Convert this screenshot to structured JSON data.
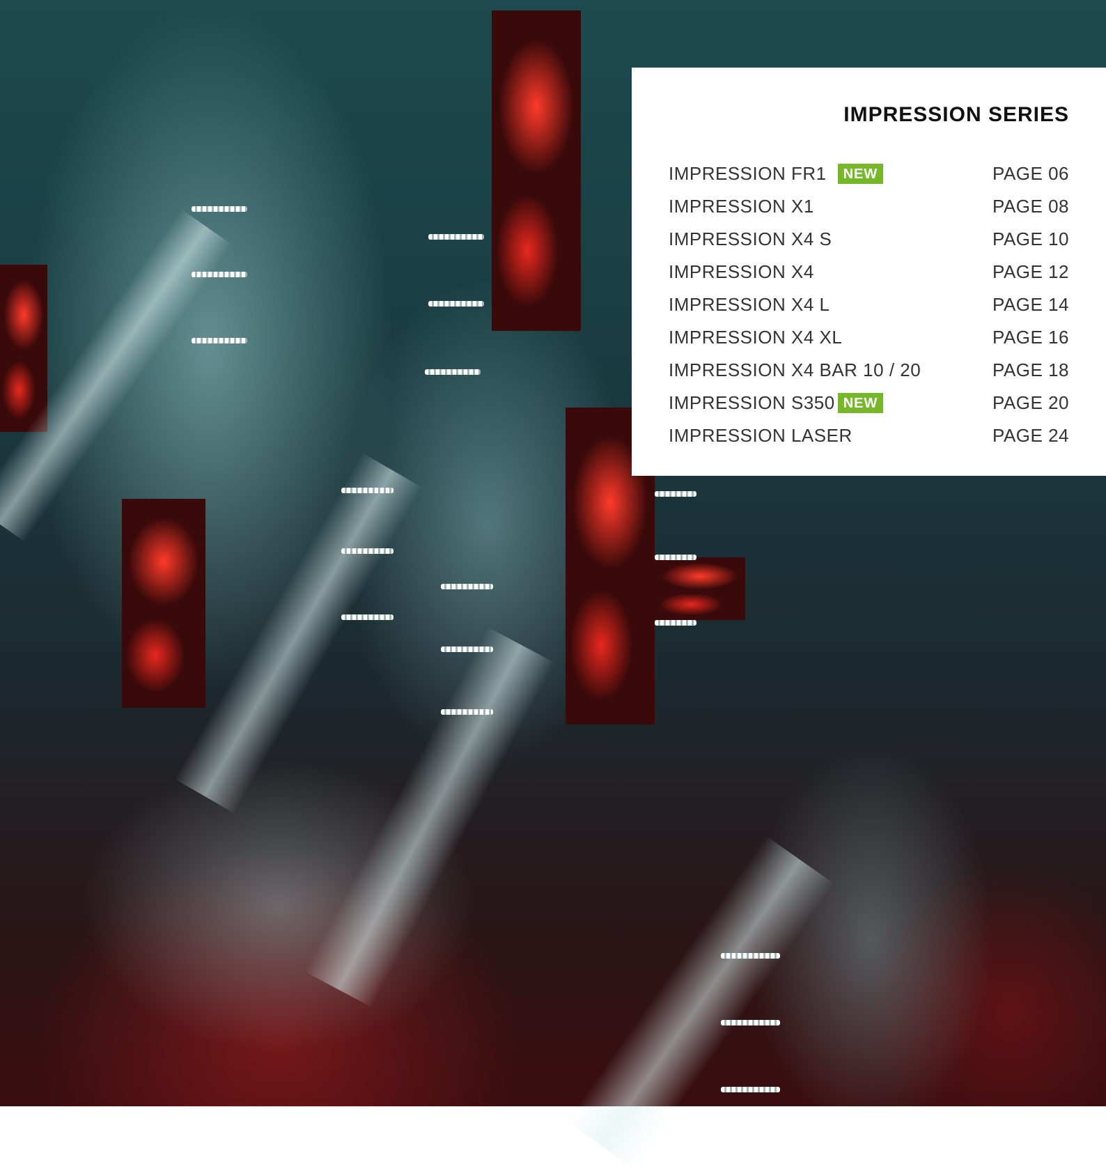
{
  "toc": {
    "title": "IMPRESSION SERIES",
    "items": [
      {
        "name": "IMPRESSION FR1",
        "badge": "NEW",
        "page": "PAGE 06"
      },
      {
        "name": "IMPRESSION X1",
        "badge": "",
        "page": "PAGE 08"
      },
      {
        "name": "IMPRESSION X4 S",
        "badge": "",
        "page": "PAGE 10"
      },
      {
        "name": "IMPRESSION X4",
        "badge": "",
        "page": "PAGE 12"
      },
      {
        "name": "IMPRESSION X4 L",
        "badge": "",
        "page": "PAGE 14"
      },
      {
        "name": "IMPRESSION X4 XL",
        "badge": "",
        "page": "PAGE 16"
      },
      {
        "name": "IMPRESSION X4 BAR 10 / 20",
        "badge": "",
        "page": "PAGE 18"
      },
      {
        "name": "IMPRESSION S350",
        "badge": "NEW",
        "page": "PAGE 20"
      },
      {
        "name": "IMPRESSION LASER",
        "badge": "",
        "page": "PAGE 24"
      }
    ]
  },
  "colors": {
    "badge": "#76b82a",
    "panel": "#ffffff",
    "title_text": "#111111",
    "item_text": "#333333"
  }
}
